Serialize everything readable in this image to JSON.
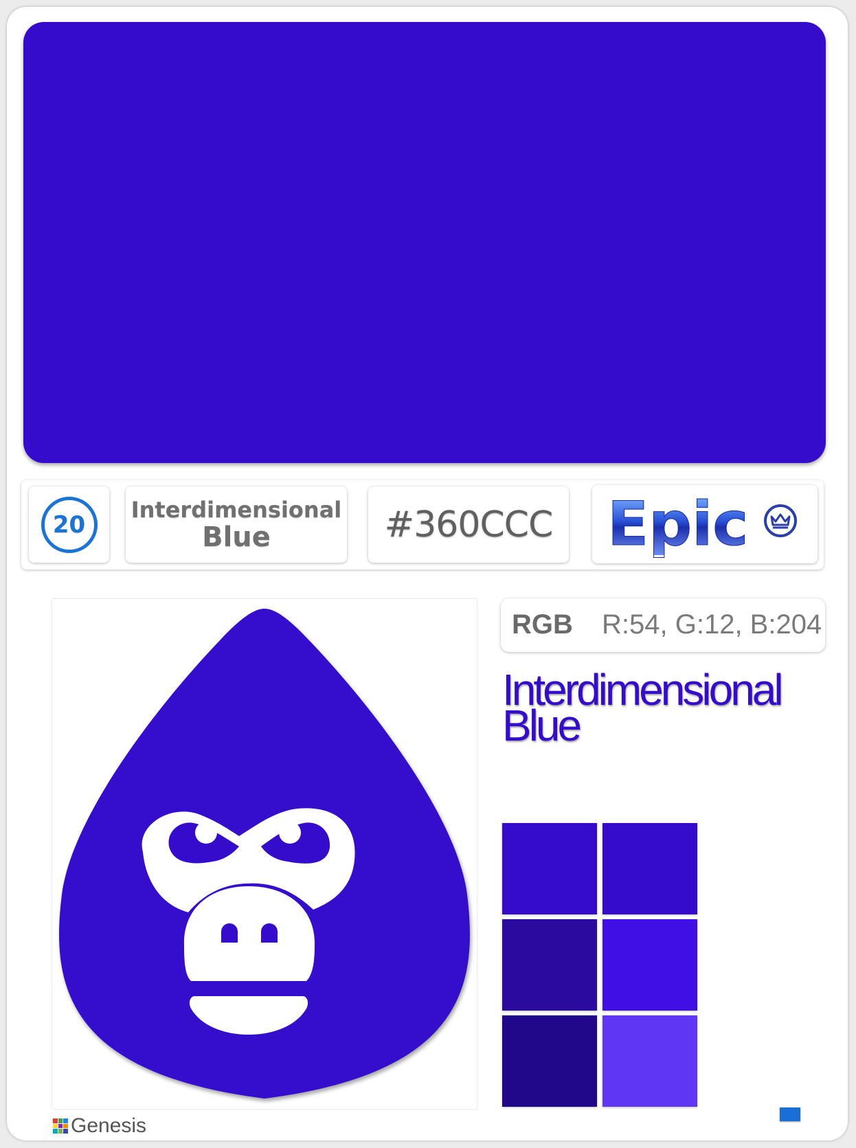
{
  "color": {
    "name_line1": "Interdimensional",
    "name_line2": "Blue",
    "hex": "#360CCC",
    "rgb_label": "RGB",
    "rgb_value": "R:54, G:12, B:204",
    "main": "#360CCC"
  },
  "badge": {
    "number": "20",
    "rarity": "Epic",
    "rarity_icon": "crown-icon"
  },
  "swatches": [
    "#360CCC",
    "#360CCC",
    "#2A0A9F",
    "#3F0FE5",
    "#210789",
    "#6036F5"
  ],
  "brand": {
    "name": "Genesis",
    "logo_icon": "grid-logo-icon"
  },
  "illustration": {
    "icon": "gorilla-face-icon",
    "shape": "drop"
  }
}
